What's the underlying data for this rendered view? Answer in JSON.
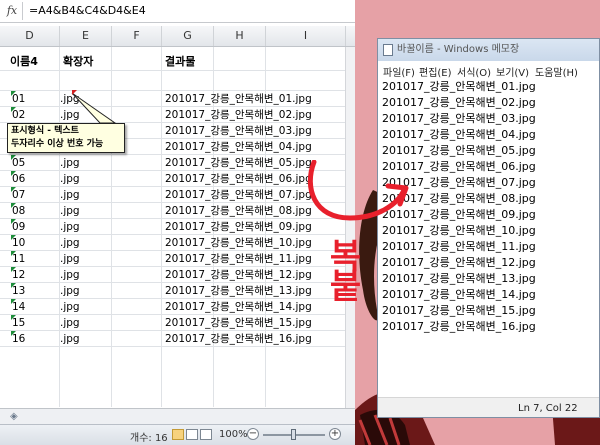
{
  "excel": {
    "formula": "=A4&B4&C4&D4&E4",
    "fx_label": "fx",
    "columns": [
      "D",
      "E",
      "F",
      "G",
      "H",
      "I"
    ],
    "headers": {
      "d": "이름4",
      "e": "확장자",
      "g": "결과물"
    },
    "rows": [
      {
        "d": "01",
        "e": ".jpg",
        "g": "201017_강릉_안목해변_01.jpg"
      },
      {
        "d": "02",
        "e": ".jpg",
        "g": "201017_강릉_안목해변_02.jpg"
      },
      {
        "d": "03",
        "e": ".jpg",
        "g": "201017_강릉_안목해변_03.jpg"
      },
      {
        "d": "04",
        "e": ".jpg",
        "g": "201017_강릉_안목해변_04.jpg"
      },
      {
        "d": "05",
        "e": ".jpg",
        "g": "201017_강릉_안목해변_05.jpg"
      },
      {
        "d": "06",
        "e": ".jpg",
        "g": "201017_강릉_안목해변_06.jpg"
      },
      {
        "d": "07",
        "e": ".jpg",
        "g": "201017_강릉_안목해변_07.jpg"
      },
      {
        "d": "08",
        "e": ".jpg",
        "g": "201017_강릉_안목해변_08.jpg"
      },
      {
        "d": "09",
        "e": ".jpg",
        "g": "201017_강릉_안목해변_09.jpg"
      },
      {
        "d": "10",
        "e": ".jpg",
        "g": "201017_강릉_안목해변_10.jpg"
      },
      {
        "d": "11",
        "e": ".jpg",
        "g": "201017_강릉_안목해변_11.jpg"
      },
      {
        "d": "12",
        "e": ".jpg",
        "g": "201017_강릉_안목해변_12.jpg"
      },
      {
        "d": "13",
        "e": ".jpg",
        "g": "201017_강릉_안목해변_13.jpg"
      },
      {
        "d": "14",
        "e": ".jpg",
        "g": "201017_강릉_안목해변_14.jpg"
      },
      {
        "d": "15",
        "e": ".jpg",
        "g": "201017_강릉_안목해변_15.jpg"
      },
      {
        "d": "16",
        "e": ".jpg",
        "g": "201017_강릉_안목해변_16.jpg"
      }
    ],
    "comment": {
      "line1": "표시형식 - 텍스트",
      "line2": "두자리수 이상 번호 가능"
    },
    "status": {
      "count": "개수: 16",
      "zoom": "100%",
      "zoom_minus": "−",
      "zoom_plus": "+"
    }
  },
  "notepad": {
    "title": "바꿀이름 - Windows 메모장",
    "menu": [
      "파일(F)",
      "편집(E)",
      "서식(O)",
      "보기(V)",
      "도움말(H)"
    ],
    "lines": [
      "201017_강릉_안목해변_01.jpg",
      "201017_강릉_안목해변_02.jpg",
      "201017_강릉_안목해변_03.jpg",
      "201017_강릉_안목해변_04.jpg",
      "201017_강릉_안목해변_05.jpg",
      "201017_강릉_안목해변_06.jpg",
      "201017_강릉_안목해변_07.jpg",
      "201017_강릉_안목해변_08.jpg",
      "201017_강릉_안목해변_09.jpg",
      "201017_강릉_안목해변_10.jpg",
      "201017_강릉_안목해변_11.jpg",
      "201017_강릉_안목해변_12.jpg",
      "201017_강릉_안목해변_13.jpg",
      "201017_강릉_안목해변_14.jpg",
      "201017_강릉_안목해변_15.jpg",
      "201017_강릉_안목해변_16.jpg"
    ],
    "status": "Ln 7, Col 22"
  },
  "annotation": {
    "label": "복붙",
    "color": "#e8202c"
  },
  "colors": {
    "background": "#e6a1a6",
    "tri_green": "#1d8d3a"
  }
}
